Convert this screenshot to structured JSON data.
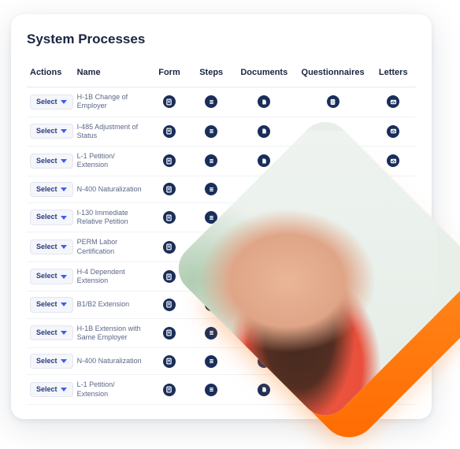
{
  "title": "System Processes",
  "select_label": "Select",
  "columns": {
    "actions": "Actions",
    "name": "Name",
    "form": "Form",
    "steps": "Steps",
    "documents": "Documents",
    "questionnaires": "Questionnaires",
    "letters": "Letters"
  },
  "rows": [
    {
      "name": "H-1B Change of Employer"
    },
    {
      "name": "I-485 Adjustment of Status"
    },
    {
      "name": "L-1 Petition/ Extension"
    },
    {
      "name": "N-400 Naturalization"
    },
    {
      "name": "I-130 Immediate Relative Petition"
    },
    {
      "name": "PERM Labor Certification"
    },
    {
      "name": "H-4 Dependent Extension"
    },
    {
      "name": "B1/B2 Extension"
    },
    {
      "name": "H-1B Extension with Same Employer"
    },
    {
      "name": "N-400 Naturalization"
    },
    {
      "name": "L-1 Petition/ Extension"
    }
  ],
  "icons": {
    "form": "form-icon",
    "steps": "steps-icon",
    "documents": "documents-icon",
    "questionnaires": "questionnaires-icon",
    "letters": "letters-icon"
  }
}
